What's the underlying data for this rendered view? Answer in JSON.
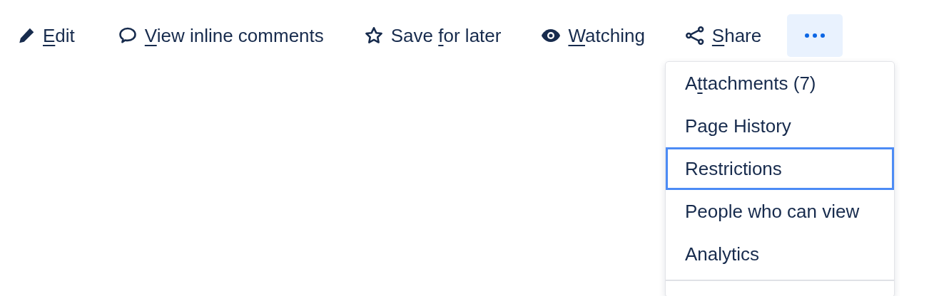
{
  "toolbar": [
    {
      "kind": "edit",
      "label": {
        "underlined": "E",
        "after": "dit"
      }
    },
    {
      "kind": "comment",
      "label": {
        "underlined": "V",
        "after": "iew inline comments"
      }
    },
    {
      "kind": "star",
      "label": {
        "before": "Save ",
        "underlined": "f",
        "after": "or later"
      }
    },
    {
      "kind": "eye",
      "label": {
        "underlined": "W",
        "after": "atching"
      }
    },
    {
      "kind": "share",
      "label": {
        "underlined": "S",
        "after": "hare"
      }
    }
  ],
  "more_button": {
    "selected": true
  },
  "menu": {
    "items": [
      {
        "label": {
          "before": "A",
          "underlined": "t",
          "after": "tachments (7)"
        },
        "selected": false
      },
      {
        "label": {
          "before": "Page History"
        },
        "selected": false
      },
      {
        "label": {
          "before": "Restrictions"
        },
        "selected": true
      },
      {
        "label": {
          "before": "People who can view"
        },
        "selected": false
      },
      {
        "label": {
          "before": "Analytics"
        },
        "selected": false
      }
    ]
  }
}
